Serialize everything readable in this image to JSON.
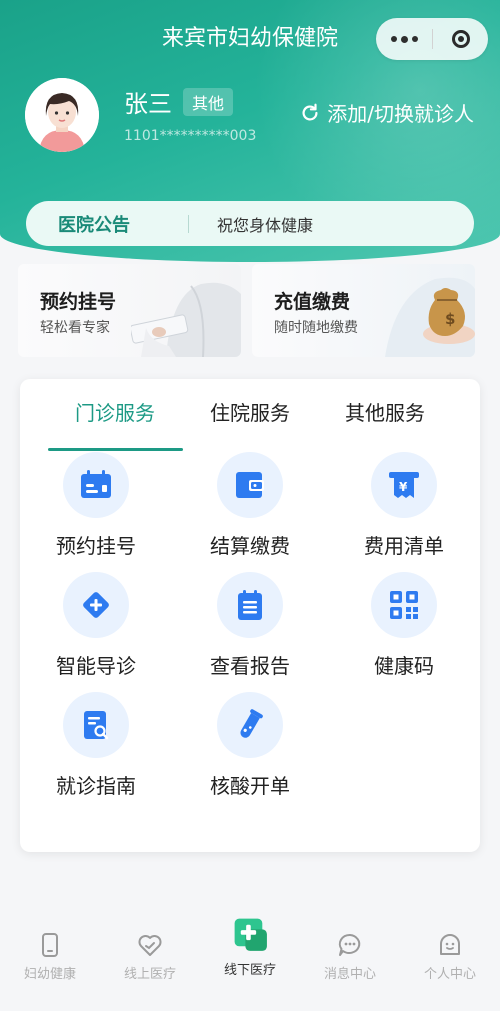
{
  "header": {
    "title": "来宾市妇幼保健院",
    "user_name": "张三",
    "relation_tag": "其他",
    "id_number": "1101**********003",
    "switch_label": "添加/切换就诊人"
  },
  "notice": {
    "label": "医院公告",
    "text": "祝您身体健康"
  },
  "cards": {
    "appointment": {
      "title": "预约挂号",
      "subtitle": "轻松看专家"
    },
    "recharge": {
      "title": "充值缴费",
      "subtitle": "随时随地缴费"
    }
  },
  "tabs": [
    "门诊服务",
    "住院服务",
    "其他服务"
  ],
  "services": [
    {
      "label": "预约挂号",
      "icon": "calendar-icon"
    },
    {
      "label": "结算缴费",
      "icon": "wallet-icon"
    },
    {
      "label": "费用清单",
      "icon": "receipt-yen-icon"
    },
    {
      "label": "智能导诊",
      "icon": "diamond-plus-icon"
    },
    {
      "label": "查看报告",
      "icon": "report-icon"
    },
    {
      "label": "健康码",
      "icon": "qrcode-icon"
    },
    {
      "label": "就诊指南",
      "icon": "document-search-icon"
    },
    {
      "label": "核酸开单",
      "icon": "test-tube-icon"
    }
  ],
  "tabbar": [
    {
      "label": "妇幼健康",
      "icon": "phone-icon"
    },
    {
      "label": "线上医疗",
      "icon": "heart-icon"
    },
    {
      "label": "线下医疗",
      "icon": "medical-cross-icon"
    },
    {
      "label": "消息中心",
      "icon": "chat-icon"
    },
    {
      "label": "个人中心",
      "icon": "person-icon"
    }
  ],
  "colors": {
    "brand": "#1d9a85",
    "icon_blue": "#2e7bf0",
    "icon_bg": "#e9f2fe"
  }
}
